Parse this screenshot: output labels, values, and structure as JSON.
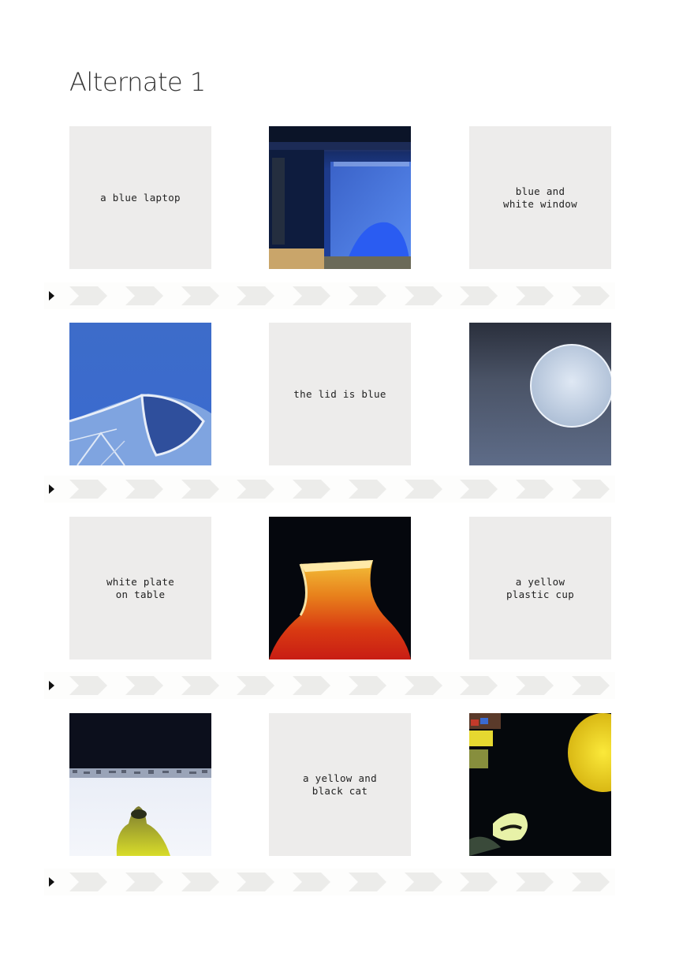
{
  "page": {
    "title": "Alternate 1"
  },
  "rows": [
    {
      "cells": [
        {
          "kind": "text",
          "caption": "a blue laptop"
        },
        {
          "kind": "image",
          "subject": "generated-image-blue-laptop"
        },
        {
          "kind": "text",
          "caption": "blue and\nwhite window"
        }
      ]
    },
    {
      "cells": [
        {
          "kind": "image",
          "subject": "generated-image-blue-window"
        },
        {
          "kind": "text",
          "caption": "the lid is blue"
        },
        {
          "kind": "image",
          "subject": "generated-image-blue-lid"
        }
      ]
    },
    {
      "cells": [
        {
          "kind": "text",
          "caption": "white plate\non table"
        },
        {
          "kind": "image",
          "subject": "generated-image-yellow-cup"
        },
        {
          "kind": "text",
          "caption": "a yellow\nplastic cup"
        }
      ]
    },
    {
      "cells": [
        {
          "kind": "image",
          "subject": "generated-image-white-plate"
        },
        {
          "kind": "text",
          "caption": "a yellow and\nblack cat"
        },
        {
          "kind": "image",
          "subject": "generated-image-yellow-black-cat"
        }
      ]
    }
  ],
  "strip": {
    "play_icon": "play-icon",
    "chevron_icon": "chevron-right-icon",
    "chevron_count": 10,
    "chevron_color": "#ececea"
  },
  "colors": {
    "card_background": "#edeceb",
    "title_color": "#333333",
    "caption_color": "#222222"
  }
}
